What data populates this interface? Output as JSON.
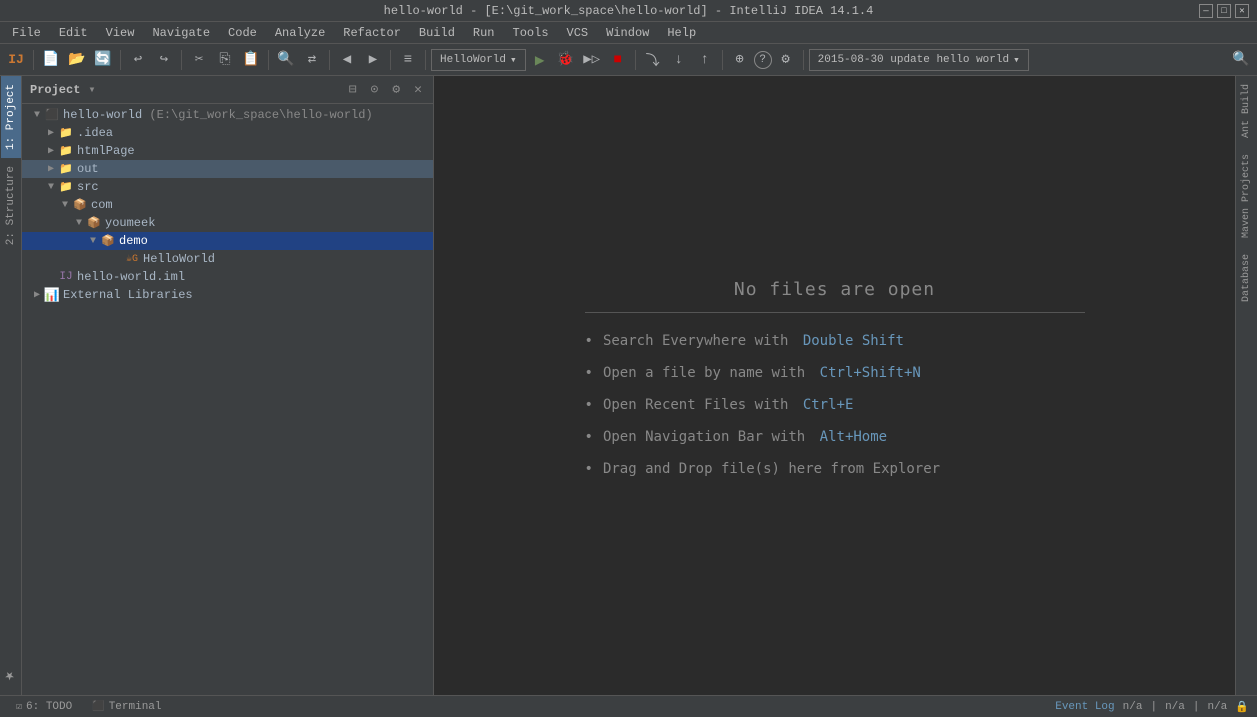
{
  "window": {
    "title": "hello-world - [E:\\git_work_space\\hello-world] - IntelliJ IDEA 14.1.4"
  },
  "menubar": {
    "items": [
      "File",
      "Edit",
      "View",
      "Navigate",
      "Code",
      "Analyze",
      "Refactor",
      "Build",
      "Run",
      "Tools",
      "VCS",
      "Window",
      "Help"
    ]
  },
  "toolbar": {
    "run_config": "HelloWorld",
    "run_config_arrow": "▾",
    "vcs_commit": "2015-08-30 update hello world",
    "vcs_commit_arrow": "▾"
  },
  "project_panel": {
    "title": "Project",
    "title_arrow": "▾",
    "tree": [
      {
        "id": "root",
        "label": "hello-world",
        "sublabel": "(E:\\git_work_space\\hello-world)",
        "indent": 0,
        "icon": "project",
        "expanded": true
      },
      {
        "id": "idea",
        "label": ".idea",
        "indent": 1,
        "icon": "folder",
        "expanded": false
      },
      {
        "id": "htmlpage",
        "label": "htmlPage",
        "indent": 1,
        "icon": "folder",
        "expanded": false
      },
      {
        "id": "out",
        "label": "out",
        "indent": 1,
        "icon": "folder",
        "expanded": false,
        "selected": false
      },
      {
        "id": "src",
        "label": "src",
        "indent": 1,
        "icon": "folder",
        "expanded": true
      },
      {
        "id": "com",
        "label": "com",
        "indent": 2,
        "icon": "package",
        "expanded": true
      },
      {
        "id": "youmeek",
        "label": "youmeek",
        "indent": 3,
        "icon": "package",
        "expanded": true
      },
      {
        "id": "demo",
        "label": "demo",
        "indent": 4,
        "icon": "package",
        "expanded": true,
        "selected": true
      },
      {
        "id": "helloworld_java",
        "label": "HelloWorld",
        "indent": 5,
        "icon": "java",
        "expanded": false
      },
      {
        "id": "helloworld_iml",
        "label": "hello-world.iml",
        "indent": 1,
        "icon": "iml",
        "expanded": false
      },
      {
        "id": "ext_libs",
        "label": "External Libraries",
        "indent": 0,
        "icon": "libraries",
        "expanded": false
      }
    ]
  },
  "editor": {
    "no_files_title": "No files are open",
    "hints": [
      {
        "text": "Search Everywhere with ",
        "key": "Double Shift"
      },
      {
        "text": "Open a file by name with ",
        "key": "Ctrl+Shift+N"
      },
      {
        "text": "Open Recent Files with ",
        "key": "Ctrl+E"
      },
      {
        "text": "Open Navigation Bar with ",
        "key": "Alt+Home"
      },
      {
        "text": "Drag and Drop file(s) here from Explorer",
        "key": ""
      }
    ]
  },
  "left_tabs": [
    "1: Project",
    "2: Structure",
    "Z: Favorites"
  ],
  "right_tabs": [
    "Ant Build",
    "Maven Projects",
    "Database"
  ],
  "bottom_bar": {
    "todo_tab": "6: TODO",
    "terminal_tab": "Terminal",
    "event_log": "Event Log",
    "status": [
      "n/a",
      "n/a",
      "n/a"
    ]
  }
}
